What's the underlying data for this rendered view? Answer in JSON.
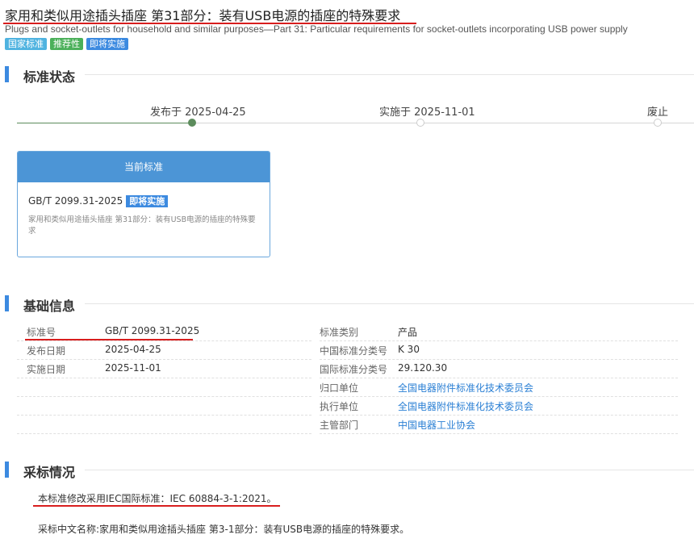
{
  "header": {
    "title_cn": "家用和类似用途插头插座 第31部分：装有USB电源的插座的特殊要求",
    "title_en": "Plugs and socket-outlets for household and similar purposes—Part 31: Particular requirements for socket-outlets incorporating USB power supply",
    "tags": [
      {
        "label": "国家标准",
        "color": "#4fb3e0"
      },
      {
        "label": "推荐性",
        "color": "#4bb05a"
      },
      {
        "label": "即将实施",
        "color": "#3c8ae0"
      }
    ]
  },
  "status": {
    "title": "标准状态",
    "timeline": [
      {
        "label": "发布于 2025-04-25",
        "state": "done"
      },
      {
        "label": "实施于 2025-11-01",
        "state": "pending"
      },
      {
        "label": "废止",
        "state": "pending"
      }
    ],
    "card": {
      "header": "当前标准",
      "code": "GB/T 2099.31-2025",
      "badge": "即将实施",
      "desc": "家用和类似用途插头插座 第31部分：装有USB电源的插座的特殊要求"
    }
  },
  "basic": {
    "title": "基础信息",
    "left": [
      {
        "label": "标准号",
        "value": "GB/T 2099.31-2025"
      },
      {
        "label": "发布日期",
        "value": "2025-04-25"
      },
      {
        "label": "实施日期",
        "value": "2025-11-01"
      }
    ],
    "right": [
      {
        "label": "标准类别",
        "value": "产品"
      },
      {
        "label": "中国标准分类号",
        "value": "K 30"
      },
      {
        "label": "国际标准分类号",
        "value": "29.120.30"
      },
      {
        "label": "归口单位",
        "value": "全国电器附件标准化技术委员会"
      },
      {
        "label": "执行单位",
        "value": "全国电器附件标准化技术委员会"
      },
      {
        "label": "主管部门",
        "value": "中国电器工业协会"
      }
    ]
  },
  "adoption": {
    "title": "采标情况",
    "line1": "本标准修改采用IEC国际标准：IEC 60884-3-1:2021。",
    "line2": "采标中文名称:家用和类似用途插头插座 第3-1部分：装有USB电源的插座的特殊要求。"
  }
}
